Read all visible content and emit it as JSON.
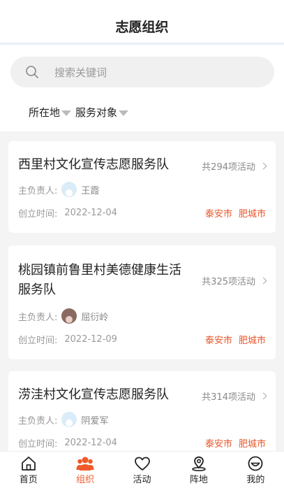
{
  "header": {
    "title": "志愿组织"
  },
  "search": {
    "placeholder": "搜索关键词"
  },
  "filters": [
    {
      "label": "所在地"
    },
    {
      "label": "服务对象"
    }
  ],
  "labels": {
    "leader": "主负责人:",
    "founded": "创立时间:"
  },
  "cards": [
    {
      "title": "西里村文化宣传志愿服务队",
      "count": "共294项活动",
      "leader": "王霞",
      "date": "2022-12-04",
      "city1": "泰安市",
      "city2": "肥城市"
    },
    {
      "title": "桃园镇前鲁里村美德健康生活服务队",
      "count": "共325项活动",
      "leader": "屈衍岭",
      "date": "2022-12-09",
      "city1": "泰安市",
      "city2": "肥城市"
    },
    {
      "title": "涝洼村文化宣传志愿服务队",
      "count": "共314项活动",
      "leader": "阴爱军",
      "date": "2022-12-04",
      "city1": "泰安市",
      "city2": "肥城市"
    }
  ],
  "tabbar": {
    "items": [
      {
        "label": "首页",
        "icon": "home-icon"
      },
      {
        "label": "组织",
        "icon": "group-icon"
      },
      {
        "label": "活动",
        "icon": "heart-icon"
      },
      {
        "label": "阵地",
        "icon": "location-icon"
      },
      {
        "label": "我的",
        "icon": "smile-icon"
      }
    ],
    "active_index": 1
  },
  "colors": {
    "accent": "#f05a2a",
    "city": "#e8562a",
    "background": "#f4f4f4"
  }
}
